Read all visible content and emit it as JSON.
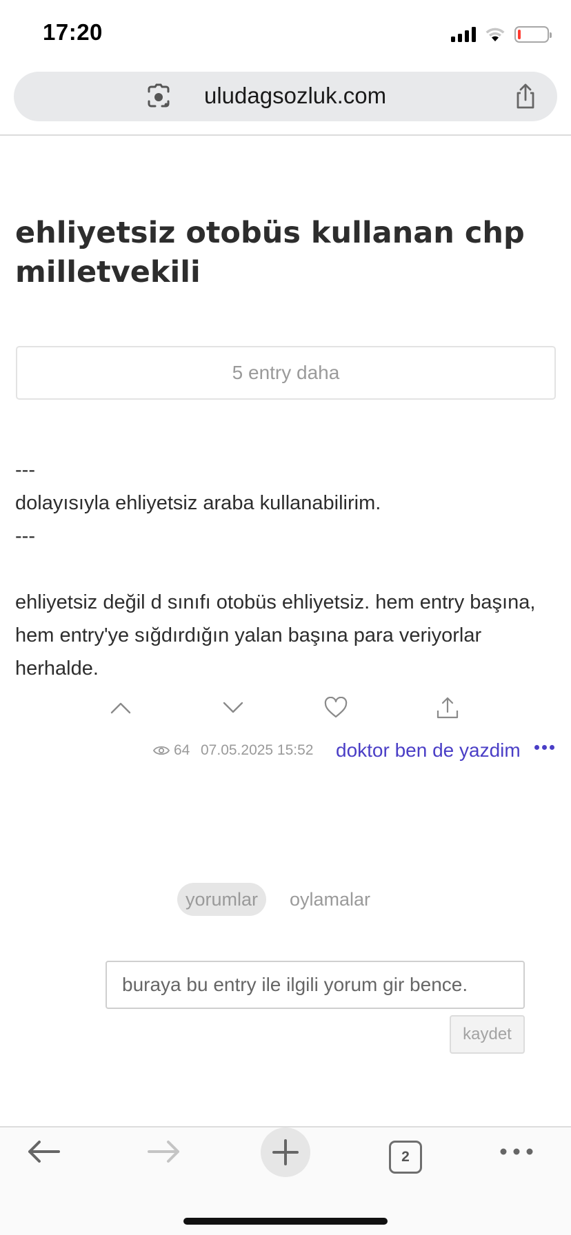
{
  "status_bar": {
    "time": "17:20",
    "signal_icon": "cellular-signal-icon",
    "wifi_icon": "wifi-icon",
    "battery_icon": "battery-low-icon",
    "battery_level_fraction": 0.1,
    "battery_color": "#ff3b30"
  },
  "browser": {
    "url": "uludagsozluk.com",
    "lens_icon": "google-lens-icon",
    "share_icon": "share-icon"
  },
  "topic": {
    "title": "ehliyetsiz otobüs kullanan chp milletvekili"
  },
  "more_entries": {
    "label": "5 entry daha"
  },
  "entry": {
    "lines": [
      "---",
      "dolayısıyla ehliyetsiz araba kullanabilirim.",
      "---"
    ],
    "paragraph": "ehliyetsiz değil d sınıfı otobüs ehliyetsiz. hem entry başına, hem entry'ye sığdırdığın yalan başına para veriyorlar herhalde.",
    "actions": [
      "upvote-icon",
      "downvote-icon",
      "favorite-heart-icon",
      "share-icon"
    ],
    "views": "64",
    "date": "07.05.2025 15:52",
    "author": "doktor ben de yazdim",
    "accent_color": "#4a3ec6"
  },
  "tabs": {
    "comments": "yorumlar",
    "votes": "oylamalar",
    "active": "yorumlar"
  },
  "comment_form": {
    "placeholder": "buraya bu entry ile ilgili yorum gir bence.",
    "value": "",
    "save_label": "kaydet"
  },
  "toolbar": {
    "back_icon": "back-arrow-icon",
    "forward_icon": "forward-arrow-icon",
    "new_tab_icon": "plus-icon",
    "tab_count": "2",
    "menu_icon": "more-horizontal-icon"
  }
}
